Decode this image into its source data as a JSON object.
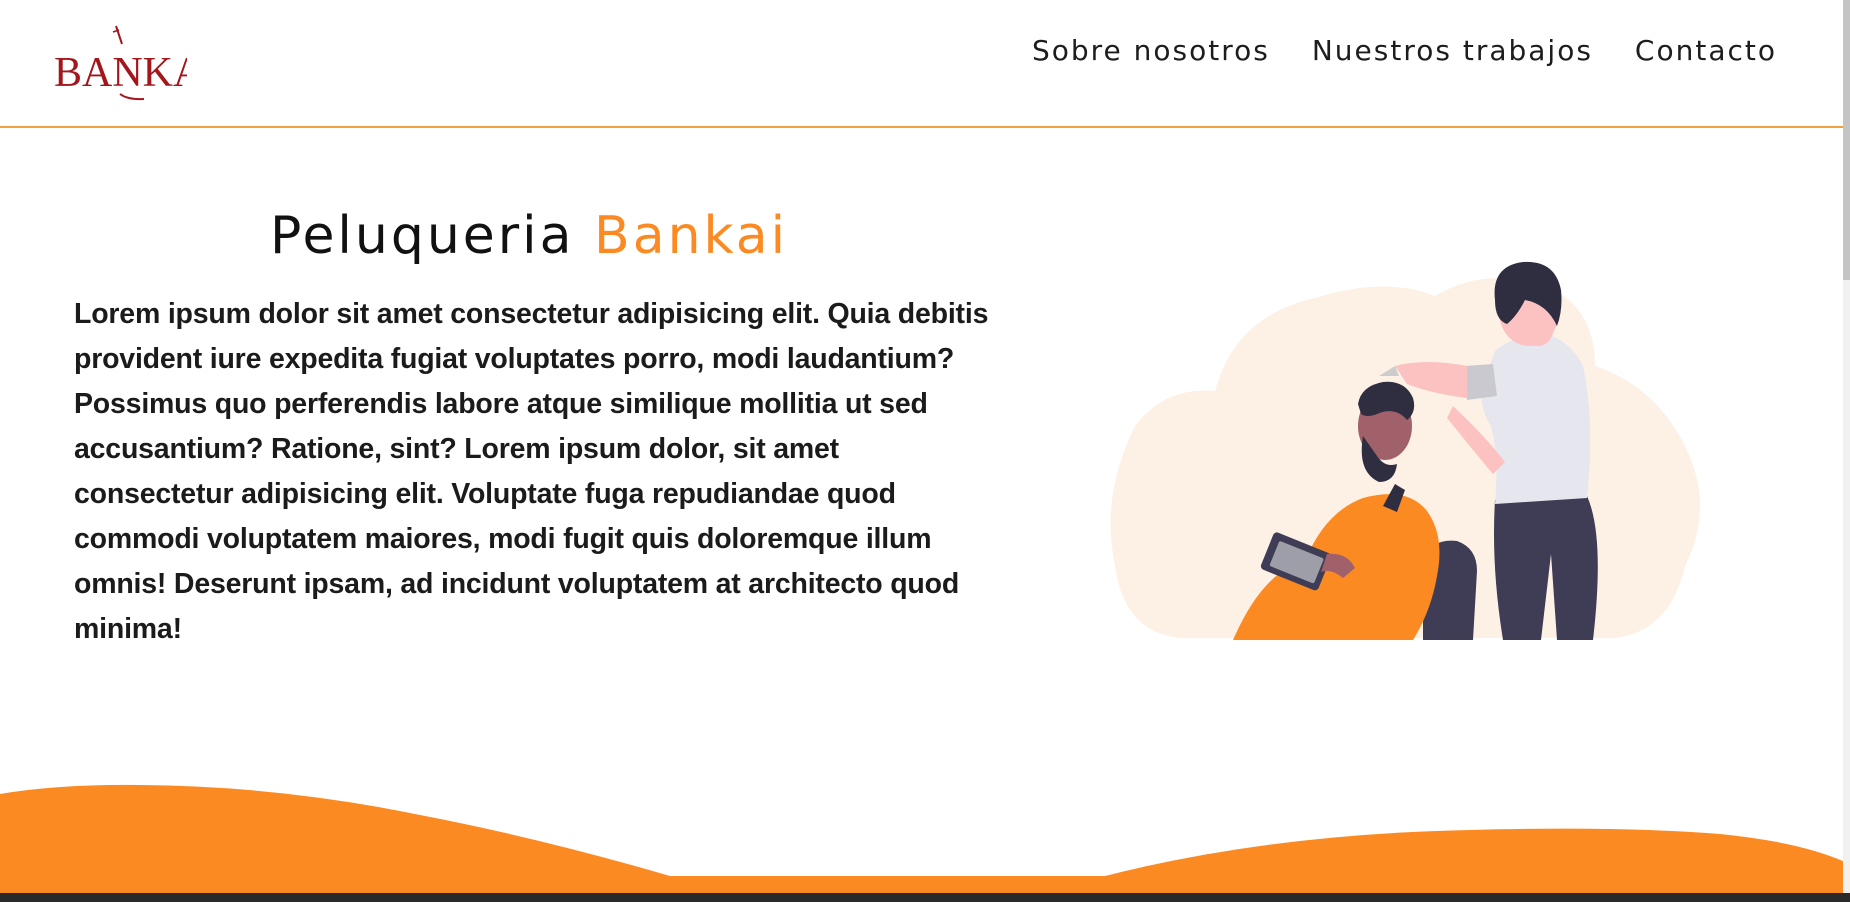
{
  "header": {
    "logo_text": "BANKAI",
    "nav": [
      {
        "label": "Sobre nosotros"
      },
      {
        "label": "Nuestros trabajos"
      },
      {
        "label": "Contacto"
      }
    ]
  },
  "hero": {
    "title_main": "Peluqueria",
    "title_accent": "Bankai",
    "text": "Lorem ipsum dolor sit amet consectetur adipisicing elit. Quia debitis provident iure expedita fugiat voluptates porro, modi laudantium? Possimus quo perferendis labore atque similique mollitia ut sed accusantium? Ratione, sint? Lorem ipsum dolor, sit amet consectetur adipisicing elit. Voluptate fuga repudiandae quod commodi voluptatem maiores, modi fugit quis doloremque illum omnis! Deserunt ipsam, ad incidunt voluptatem at architecto quod minima!"
  },
  "colors": {
    "accent": "#fb8a22",
    "logo": "#a3161b",
    "header_border": "#f1a13f",
    "text": "#1b1b1b"
  },
  "icons": {
    "logo": "bankai-logo",
    "illustration": "barber-illustration"
  }
}
